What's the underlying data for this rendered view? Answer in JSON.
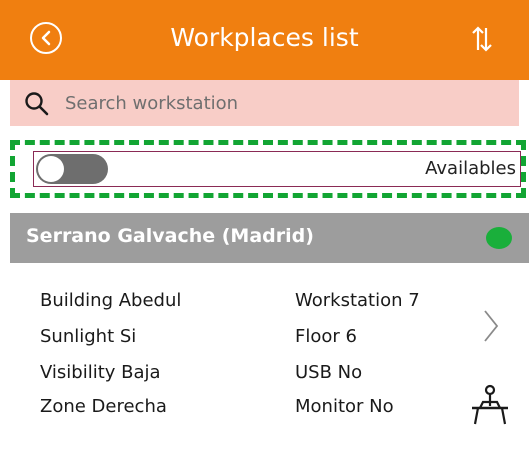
{
  "header": {
    "title": "Workplaces list",
    "back_icon": "circle-back-arrow-icon",
    "sort_icon": "sort-arrows-icon",
    "bg_color": "#f07f10"
  },
  "search": {
    "placeholder": "Search workstation",
    "value": "",
    "icon": "search-icon",
    "bg_color": "#f8cdc7"
  },
  "filter": {
    "label": "Availables",
    "toggle_on": false,
    "highlight_color": "#12a533"
  },
  "workplace": {
    "title": "Serrano Galvache (Madrid)",
    "status_color": "#1aaf3b",
    "details_left": [
      "Building Abedul",
      "Sunlight Si",
      "Visibility Baja",
      "Zone Derecha"
    ],
    "details_right": [
      "Workstation 7",
      "Floor 6",
      "USB No",
      "Monitor No"
    ],
    "action_icon": "chevron-right-icon",
    "type_icon": "workstation-desk-icon"
  }
}
